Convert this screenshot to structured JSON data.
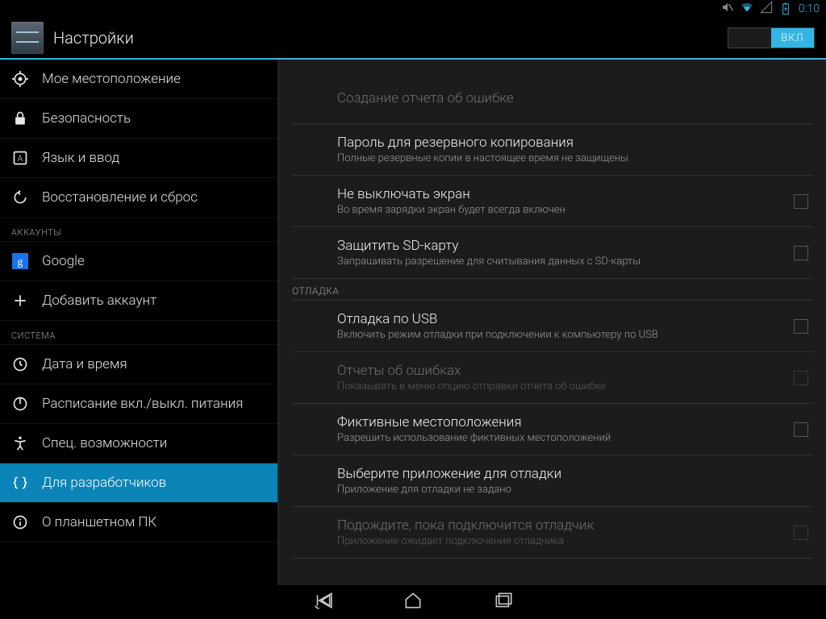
{
  "status": {
    "time": "0:10"
  },
  "header": {
    "title": "Настройки",
    "toggle_label": "ВКЛ"
  },
  "sidebar": {
    "items": [
      {
        "label": "Мое местоположение"
      },
      {
        "label": "Безопасность"
      },
      {
        "label": "Язык и ввод"
      },
      {
        "label": "Восстановление и сброс"
      }
    ],
    "section_accounts": "АККАУНТЫ",
    "accounts": [
      {
        "label": "Google"
      },
      {
        "label": "Добавить аккаунт"
      }
    ],
    "section_system": "СИСТЕМА",
    "system": [
      {
        "label": "Дата и время"
      },
      {
        "label": "Расписание вкл./выкл. питания"
      },
      {
        "label": "Спец. возможности"
      },
      {
        "label": "Для разработчиков"
      },
      {
        "label": "О планшетном ПК"
      }
    ]
  },
  "content": {
    "items": [
      {
        "title": "Создание отчета об ошибке",
        "subtitle": ""
      },
      {
        "title": "Пароль для резервного копирования",
        "subtitle": "Полные резервные копии в настоящее время не защищены"
      },
      {
        "title": "Не выключать экран",
        "subtitle": "Во время зарядки экран будет всегда включен"
      },
      {
        "title": "Защитить SD-карту",
        "subtitle": "Запрашивать разрешение для считывания данных с SD-карты"
      }
    ],
    "section_debug": "ОТЛАДКА",
    "debug_items": [
      {
        "title": "Отладка по USB",
        "subtitle": "Включить режим отладки при подключении к компьютеру по USB"
      },
      {
        "title": "Отчеты об ошибках",
        "subtitle": "Показывать в меню опцию отправки отчета об ошибке"
      },
      {
        "title": "Фиктивные местоположения",
        "subtitle": "Разрешить использование фиктивных местоположений"
      },
      {
        "title": "Выберите приложение для отладки",
        "subtitle": "Приложение для отладки не задано"
      },
      {
        "title": "Подождите, пока подключится отладчик",
        "subtitle": "Приложение ожидает подключения отладчика"
      }
    ]
  }
}
